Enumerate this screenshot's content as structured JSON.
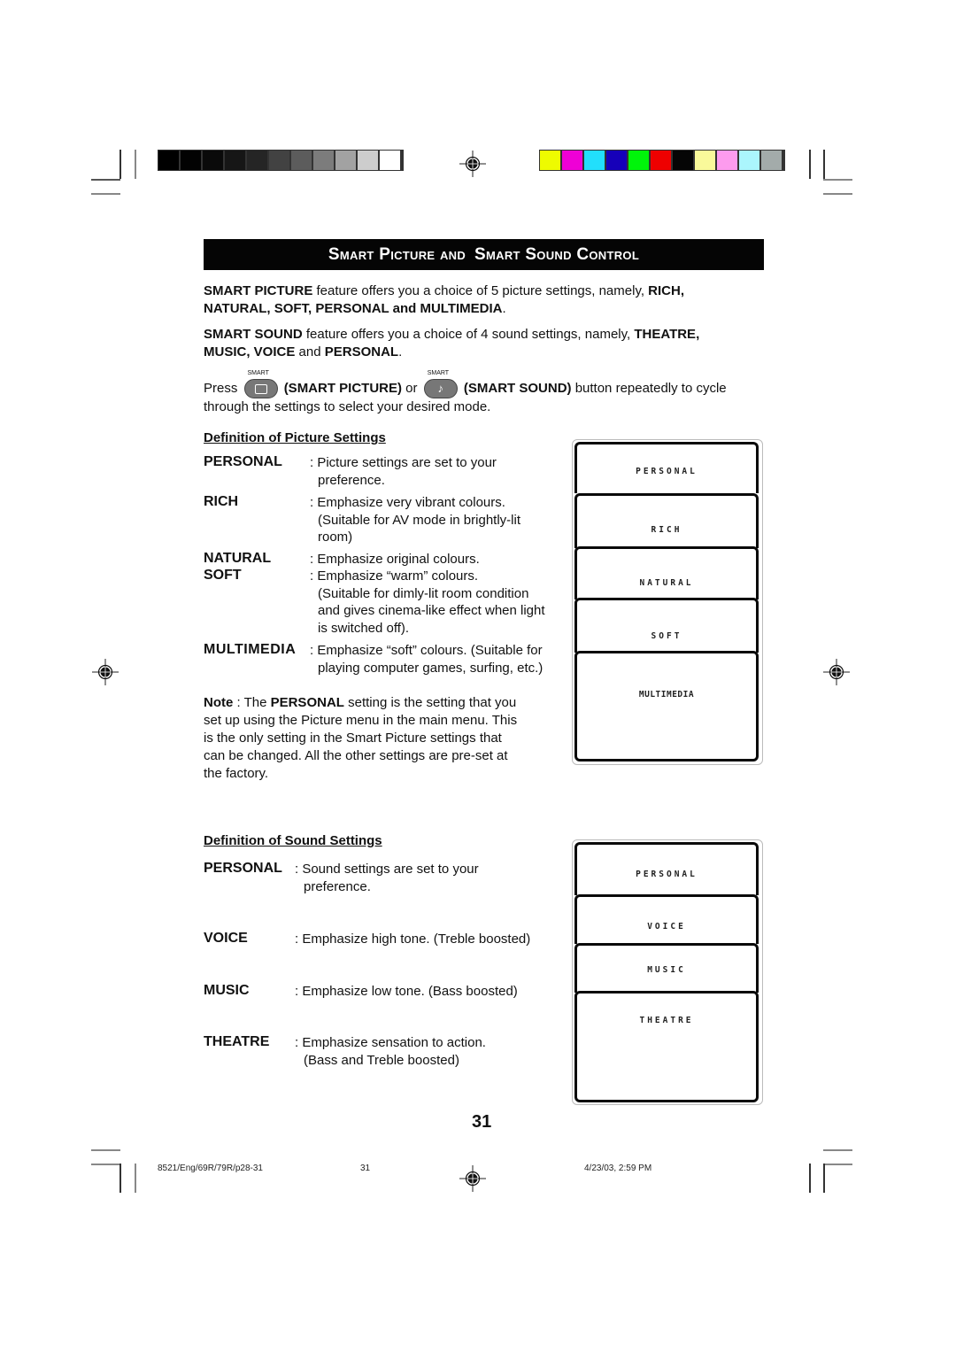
{
  "header": {
    "grayscale_bar": [
      "#000000",
      "#020202",
      "#0a0a0a",
      "#161616",
      "#252525",
      "#424242",
      "#5c5c5c",
      "#7c7c7c",
      "#a2a2a2",
      "#cdcdcd",
      "#ffffff"
    ],
    "color_bar": [
      "#eefb00",
      "#ef00d6",
      "#22dffc",
      "#1600b9",
      "#00f50a",
      "#ee0000",
      "#050505",
      "#f9f99a",
      "#fd9bee",
      "#abf6fd",
      "#a3abaa"
    ]
  },
  "title": {
    "words": [
      "Smart Picture and",
      "Smart Sound Control"
    ]
  },
  "intro": {
    "p1": {
      "b1": "SMART PICTURE",
      "t1": " feature offers you a choice of 5 picture settings, namely, ",
      "b2": "RICH,",
      "b3": "NATURAL,  SOFT,  PERSONAL and MULTIMEDIA",
      "t2": "."
    },
    "p2": {
      "b1": "SMART SOUND",
      "t1": " feature offers you a choice of 4 sound settings, namely, ",
      "b2": "THEATRE,",
      "b3": "MUSIC, VOICE",
      "t2": " and ",
      "b4": "PERSONAL",
      "t3": "."
    },
    "p3": {
      "press": "Press",
      "btn_label": "SMART",
      "b1": "(SMART PICTURE)",
      "or": " or ",
      "note_glyph": "♪",
      "b2": "(SMART SOUND)",
      "t1": " button repeatedly to cycle",
      "t2": "through the settings to select your desired mode."
    }
  },
  "picture_section": {
    "heading": "Definition of Picture Settings",
    "definitions": [
      {
        "term": "PERSONAL",
        "desc": [
          ": Picture settings are set to your",
          "preference."
        ]
      },
      {
        "term": "RICH",
        "desc": [
          ": Emphasize very vibrant colours.",
          "(Suitable for AV mode in brightly-lit",
          "room)"
        ]
      },
      {
        "term": "NATURAL",
        "desc": [
          ": Emphasize original colours."
        ]
      },
      {
        "term": "SOFT",
        "desc": [
          ": Emphasize “warm” colours.",
          "(Suitable for dimly-lit room condition",
          "and  gives cinema-like effect when light",
          "is switched off)."
        ]
      },
      {
        "term": "MULTIMEDIA",
        "desc": [
          ": Emphasize “soft” colours. (Suitable for",
          "playing computer games, surfing, etc.)"
        ]
      }
    ],
    "note": {
      "label": "Note",
      "t1": " :  The ",
      "b1": "PERSONAL",
      "t2": " setting is the setting that you",
      "lines": [
        "set up using the Picture menu in the main menu. This",
        "is the only setting in the Smart Picture settings that",
        "can be changed.  All the other settings are pre-set at",
        "the factory."
      ]
    },
    "osd_cards": [
      "PERSONAL",
      "RICH",
      "NATURAL",
      "SOFT",
      "MULTIMEDIA"
    ]
  },
  "sound_section": {
    "heading": "Definition of Sound Settings",
    "definitions": [
      {
        "term": "PERSONAL",
        "desc": [
          ": Sound settings are set to your",
          "preference."
        ]
      },
      {
        "term": "VOICE",
        "desc": [
          ": Emphasize high tone. (Treble boosted)"
        ]
      },
      {
        "term": "MUSIC",
        "desc": [
          ": Emphasize low tone. (Bass boosted)"
        ]
      },
      {
        "term": "THEATRE",
        "desc": [
          ": Emphasize sensation to action.",
          "(Bass and Treble boosted)"
        ]
      }
    ],
    "osd_cards": [
      "PERSONAL",
      "VOICE",
      "MUSIC",
      "THEATRE"
    ]
  },
  "footer": {
    "page_number": "31",
    "file_slug": "8521/Eng/69R/79R/p28-31",
    "small_page": "31",
    "timestamp": "4/23/03, 2:59 PM"
  }
}
